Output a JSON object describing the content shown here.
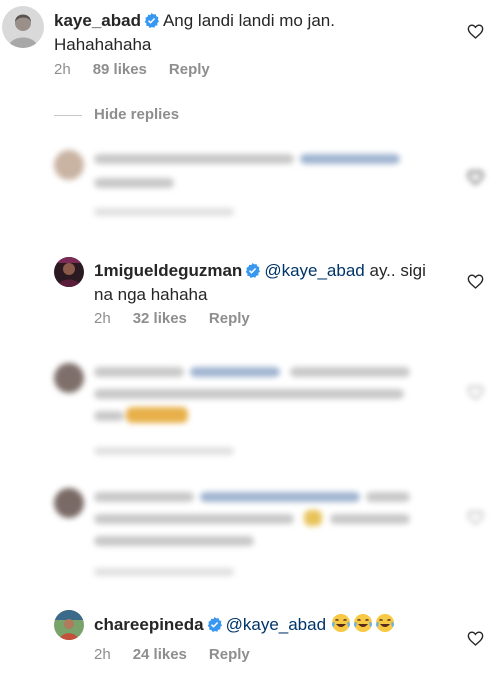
{
  "comments": {
    "kaye": {
      "username": "kaye_abad",
      "text_line1": "Ang landi landi mo jan.",
      "text_line2": "Hahahahaha",
      "time": "2h",
      "likes": "89 likes",
      "reply": "Reply"
    },
    "hide_replies": "Hide replies",
    "miguel": {
      "username": "1migueldeguzman",
      "mention": "@kaye_abad",
      "text_rest": " ay.. sigi",
      "text_line2": "na nga hahaha",
      "time": "2h",
      "likes": "32 likes",
      "reply": "Reply"
    },
    "charee": {
      "username": "chareepineda",
      "mention": "@kaye_abad",
      "time": "2h",
      "likes": "24 likes",
      "reply": "Reply"
    }
  },
  "colors": {
    "verified": "#3897f0",
    "meta_gray": "#8e8e8e",
    "mention_blue": "#003569"
  },
  "icons": {
    "heart": "heart-outline-icon",
    "verified": "verified-badge-icon",
    "emoji": "face-with-tears-of-joy-emoji"
  }
}
